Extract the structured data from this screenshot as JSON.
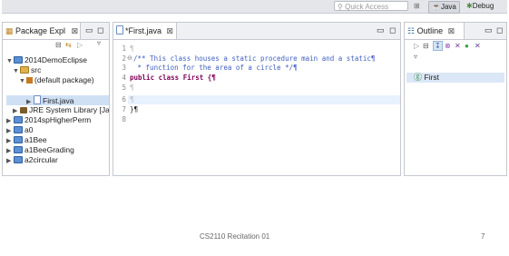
{
  "toolbar": {
    "quick_access_placeholder": "Quick Access",
    "perspective_java": "Java",
    "perspective_debug": "Debug"
  },
  "package_explorer": {
    "tab_label": "Package Expl",
    "tab_close": "⊠",
    "tree": [
      {
        "label": "2014DemoEclipse",
        "icon": "project-icon",
        "expanded": true
      },
      {
        "label": "src",
        "icon": "source-folder-icon",
        "expanded": true
      },
      {
        "label": "(default package)",
        "icon": "package-icon",
        "expanded": true
      },
      {
        "label": "First.java",
        "icon": "java-file-icon",
        "selected": true
      },
      {
        "label": "JRE System Library [Java",
        "icon": "library-icon"
      },
      {
        "label": "2014spHigherPerm",
        "icon": "project-icon"
      },
      {
        "label": "a0",
        "icon": "project-icon"
      },
      {
        "label": "a1Bee",
        "icon": "project-icon"
      },
      {
        "label": "a1BeeGrading",
        "icon": "project-icon"
      },
      {
        "label": "a2circular",
        "icon": "project-icon"
      }
    ]
  },
  "editor": {
    "tab_label": "*First.java",
    "tab_close": "⊠",
    "lines": [
      {
        "num": "1",
        "text": "¶"
      },
      {
        "num": "2",
        "text": "/** This class houses a static procedure main and a static¶"
      },
      {
        "num": "3",
        "text": " * function for the area of a circle */¶"
      },
      {
        "num": "4",
        "text": "public class First {¶"
      },
      {
        "num": "5",
        "text": "¶"
      },
      {
        "num": "6",
        "text": "¶"
      },
      {
        "num": "7",
        "text": "}¶"
      },
      {
        "num": "8",
        "text": ""
      }
    ]
  },
  "outline": {
    "tab_label": "Outline",
    "tab_close": "⊠",
    "items": [
      {
        "label": "First",
        "icon": "class-icon"
      }
    ]
  },
  "footer": {
    "text": "CS2110 Recitation 01",
    "page_number": "7"
  }
}
